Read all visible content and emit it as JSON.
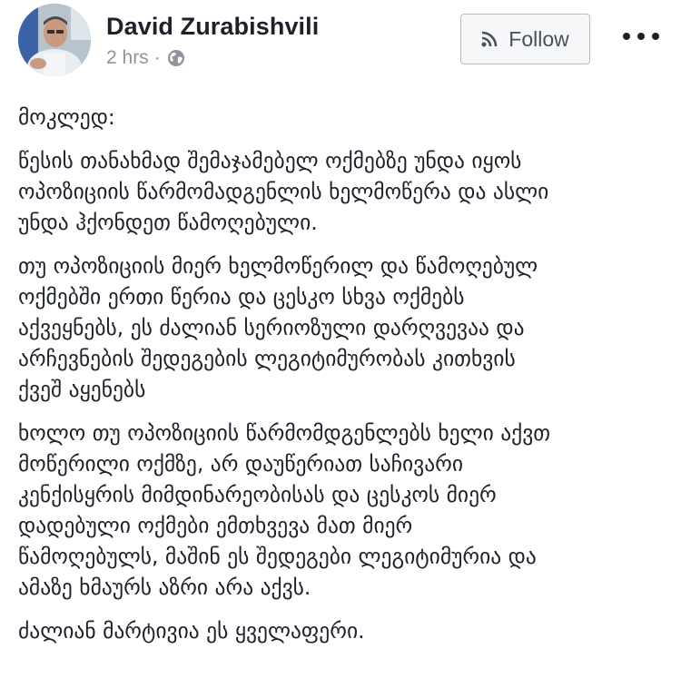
{
  "post": {
    "author": "David Zurabishvili",
    "time": "2 hrs",
    "separator": "·",
    "privacy_icon": "globe-icon",
    "follow_label": "Follow",
    "follow_icon": "rss-icon",
    "more_icon": "more-dots-icon",
    "paragraphs": [
      [
        "მოკლედ:"
      ],
      [
        "წესის თანახმად შემაჯამებელ ოქმებზე უნდა იყოს",
        "ოპოზიციის წარმომადგენლის ხელმოწერა და ასლი",
        "უნდა ჰქონდეთ წამოღებული."
      ],
      [
        "თუ ოპოზიციის მიერ ხელმოწერილ და წამოღებულ",
        "ოქმებში ერთი წერია და ცესკო სხვა ოქმებს",
        "აქვეყნებს, ეს ძალიან სერიოზული დარღვევაა და",
        "არჩევნების შედეგების ლეგიტიმურობას კითხვის",
        "ქვეშ აყენებს"
      ],
      [
        "ხოლო თუ ოპოზიციის წარმომდგენლებს ხელი აქვთ",
        "მოწერილი ოქმზე, არ დაუწერიათ საჩივარი",
        "კენქისყრის მიმდინარეობისას და ცესკოს მიერ",
        "დადებული ოქმები ემთხვევა მათ მიერ",
        "წამოღებულს, მაშინ ეს შედეგები ლეგიტიმურია და",
        "ამაზე ხმაურს აზრი არა აქვს."
      ],
      [
        "ძალიან მარტივია ეს ყველაფერი."
      ]
    ]
  }
}
